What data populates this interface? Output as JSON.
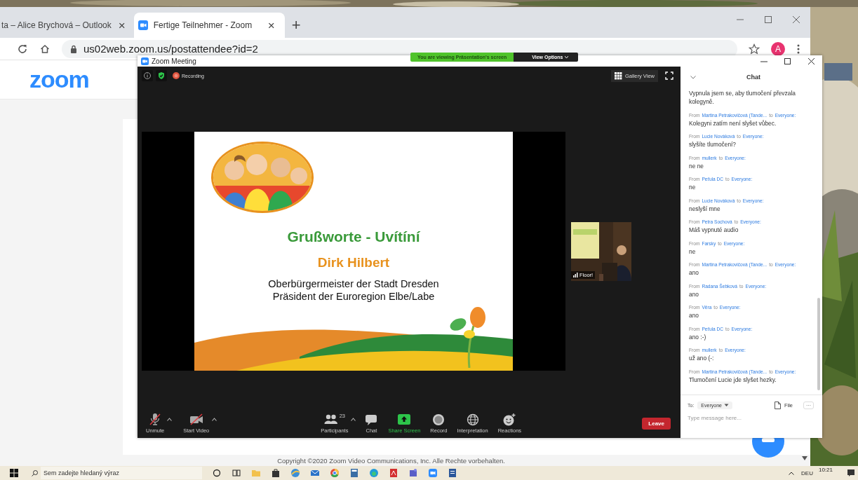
{
  "browser": {
    "tabs": [
      {
        "title": "ta – Alice Brychová – Outlook",
        "selected": false,
        "favicon": false,
        "close": "×"
      },
      {
        "title": "Fertige Teilnehmer - Zoom",
        "selected": true,
        "favicon": true,
        "close": "×"
      }
    ],
    "new_tab": "+",
    "address": "us02web.zoom.us/postattendee?id=2",
    "profile_initial": "A",
    "page": {
      "logo": "zoom",
      "copyright": "Copyright ©2020 Zoom Video Communications, Inc. Alle Rechte vorbehalten."
    }
  },
  "zoom_window": {
    "title": "Zoom Meeting",
    "share_banner": "You are viewing Präsentation's screen",
    "view_options": "View Options",
    "recording_label": "Recording",
    "gallery_view": "Gallery View",
    "slide": {
      "title": "Grußworte - Uvítíní",
      "speaker": "Dirk Hilbert",
      "lines": [
        "Oberbürgermeister der Stadt Dresden",
        "Präsident der Euroregion Elbe/Labe"
      ]
    },
    "thumbnail": {
      "name": "Floor!"
    },
    "toolbar": [
      {
        "kind": "mic",
        "label": "Unmute",
        "off": true,
        "caret": true
      },
      {
        "kind": "video",
        "label": "Start Video",
        "off": true,
        "caret": true
      },
      {
        "kind": "participants",
        "label": "Participants",
        "count": "23",
        "caret": true
      },
      {
        "kind": "chat",
        "label": "Chat"
      },
      {
        "kind": "share",
        "label": "Share Screen",
        "highlight": true
      },
      {
        "kind": "record",
        "label": "Record"
      },
      {
        "kind": "interpretation",
        "label": "Interpretation"
      },
      {
        "kind": "reactions",
        "label": "Reactions"
      }
    ],
    "leave": "Leave",
    "chat": {
      "title": "Chat",
      "messages": [
        {
          "text": "Vypnula jsem se, aby tlumočení převzala kolegyně."
        },
        {
          "from_label": "From",
          "sender": "Martina Petrakovičová (Tande...",
          "to_label": "to",
          "recipient": "Everyone:",
          "text": "Kolegyni zatím není slyšet vůbec."
        },
        {
          "from_label": "From",
          "sender": "Lucie Nováková",
          "to_label": "to",
          "recipient": "Everyone:",
          "text": "slyšíte tlumočení?"
        },
        {
          "from_label": "From",
          "sender": "mullerk",
          "to_label": "to",
          "recipient": "Everyone:",
          "text": "ne ne"
        },
        {
          "from_label": "From",
          "sender": "Peťula DC",
          "to_label": "to",
          "recipient": "Everyone:",
          "text": "ne"
        },
        {
          "from_label": "From",
          "sender": "Lucie Nováková",
          "to_label": "to",
          "recipient": "Everyone:",
          "text": "neslyší mne"
        },
        {
          "from_label": "From",
          "sender": "Petra Sochová",
          "to_label": "to",
          "recipient": "Everyone:",
          "text": "Máš vypnuté audio"
        },
        {
          "from_label": "From",
          "sender": "Farsky",
          "to_label": "to",
          "recipient": "Everyone:",
          "text": "ne"
        },
        {
          "from_label": "From",
          "sender": "Martina Petrakovičová (Tande...",
          "to_label": "to",
          "recipient": "Everyone:",
          "text": "ano"
        },
        {
          "from_label": "From",
          "sender": "Radana Šebková",
          "to_label": "to",
          "recipient": "Everyone:",
          "text": "ano"
        },
        {
          "from_label": "From",
          "sender": "Věra",
          "to_label": "to",
          "recipient": "Everyone:",
          "text": "ano"
        },
        {
          "from_label": "From",
          "sender": "Peťula DC",
          "to_label": "to",
          "recipient": "Everyone:",
          "text": "ano :-)"
        },
        {
          "from_label": "From",
          "sender": "mullerk",
          "to_label": "to",
          "recipient": "Everyone:",
          "text": "už ano (-:"
        },
        {
          "from_label": "From",
          "sender": "Martina Petrakovičová (Tande...",
          "to_label": "to",
          "recipient": "Everyone:",
          "text": "Tlumočení Lucie jde slyšet hezky."
        }
      ],
      "to_label": "To:",
      "recipient": "Everyone",
      "file": "File",
      "more": "···",
      "placeholder": "Type message here..."
    }
  },
  "taskbar": {
    "search_placeholder": "Sem zadejte hledaný výraz",
    "language": "DEU",
    "time": "10:21"
  }
}
